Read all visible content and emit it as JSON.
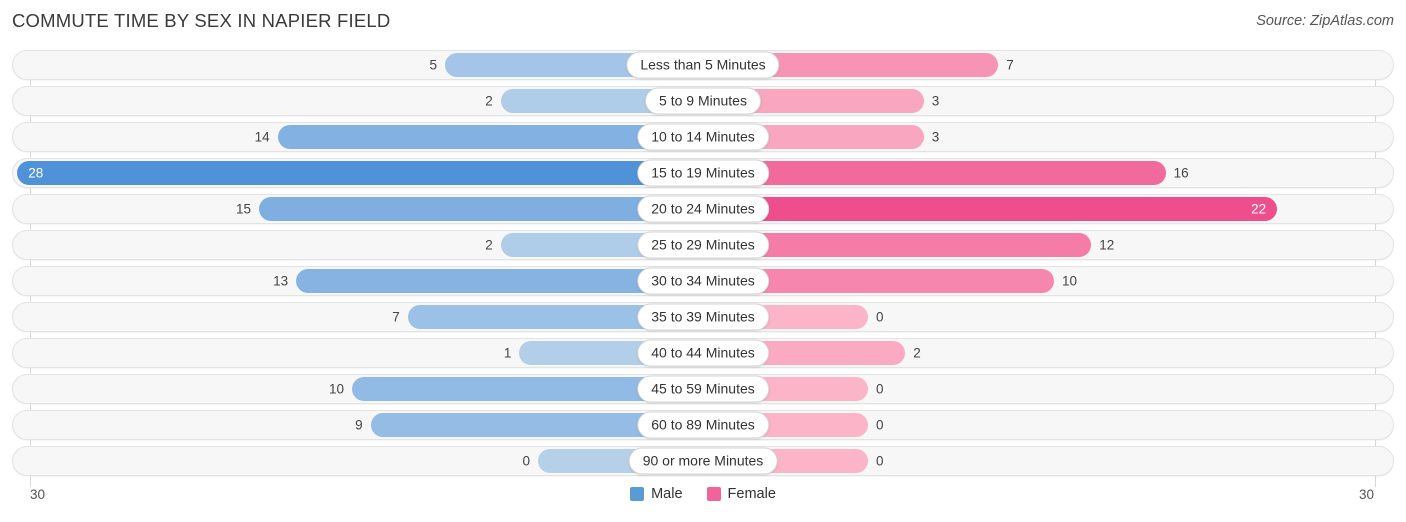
{
  "header": {
    "title": "COMMUTE TIME BY SEX IN NAPIER FIELD",
    "source": "Source: ZipAtlas.com"
  },
  "legend": {
    "male_label": "Male",
    "female_label": "Female",
    "male_color": "#5b9bd5",
    "female_color": "#f2639b"
  },
  "axis": {
    "left_tick": "30",
    "right_tick": "30"
  },
  "chart_data": {
    "type": "bar",
    "title": "COMMUTE TIME BY SEX IN NAPIER FIELD",
    "orientation": "horizontal-diverging",
    "xlabel": "",
    "ylabel": "",
    "xlim": [
      30,
      30
    ],
    "grid": true,
    "legend_position": "bottom-center",
    "categories": [
      "Less than 5 Minutes",
      "5 to 9 Minutes",
      "10 to 14 Minutes",
      "15 to 19 Minutes",
      "20 to 24 Minutes",
      "25 to 29 Minutes",
      "30 to 34 Minutes",
      "35 to 39 Minutes",
      "40 to 44 Minutes",
      "45 to 59 Minutes",
      "60 to 89 Minutes",
      "90 or more Minutes"
    ],
    "series": [
      {
        "name": "Male",
        "values": [
          5,
          2,
          14,
          28,
          15,
          2,
          13,
          7,
          1,
          10,
          9,
          0
        ]
      },
      {
        "name": "Female",
        "values": [
          7,
          3,
          3,
          16,
          22,
          12,
          10,
          0,
          2,
          0,
          0,
          0
        ]
      }
    ]
  },
  "rows": [
    {
      "category": "Less than 5 Minutes",
      "male": "5",
      "female": "7",
      "male_inside": false,
      "female_inside": false
    },
    {
      "category": "5 to 9 Minutes",
      "male": "2",
      "female": "3",
      "male_inside": false,
      "female_inside": false
    },
    {
      "category": "10 to 14 Minutes",
      "male": "14",
      "female": "3",
      "male_inside": false,
      "female_inside": false
    },
    {
      "category": "15 to 19 Minutes",
      "male": "28",
      "female": "16",
      "male_inside": true,
      "female_inside": false
    },
    {
      "category": "20 to 24 Minutes",
      "male": "15",
      "female": "22",
      "male_inside": false,
      "female_inside": true
    },
    {
      "category": "25 to 29 Minutes",
      "male": "2",
      "female": "12",
      "male_inside": false,
      "female_inside": false
    },
    {
      "category": "30 to 34 Minutes",
      "male": "13",
      "female": "10",
      "male_inside": false,
      "female_inside": false
    },
    {
      "category": "35 to 39 Minutes",
      "male": "7",
      "female": "0",
      "male_inside": false,
      "female_inside": false
    },
    {
      "category": "40 to 44 Minutes",
      "male": "1",
      "female": "2",
      "male_inside": false,
      "female_inside": false
    },
    {
      "category": "45 to 59 Minutes",
      "male": "10",
      "female": "0",
      "male_inside": false,
      "female_inside": false
    },
    {
      "category": "60 to 89 Minutes",
      "male": "9",
      "female": "0",
      "male_inside": false,
      "female_inside": false
    },
    {
      "category": "90 or more Minutes",
      "male": "0",
      "female": "0",
      "male_inside": false,
      "female_inside": false
    }
  ]
}
